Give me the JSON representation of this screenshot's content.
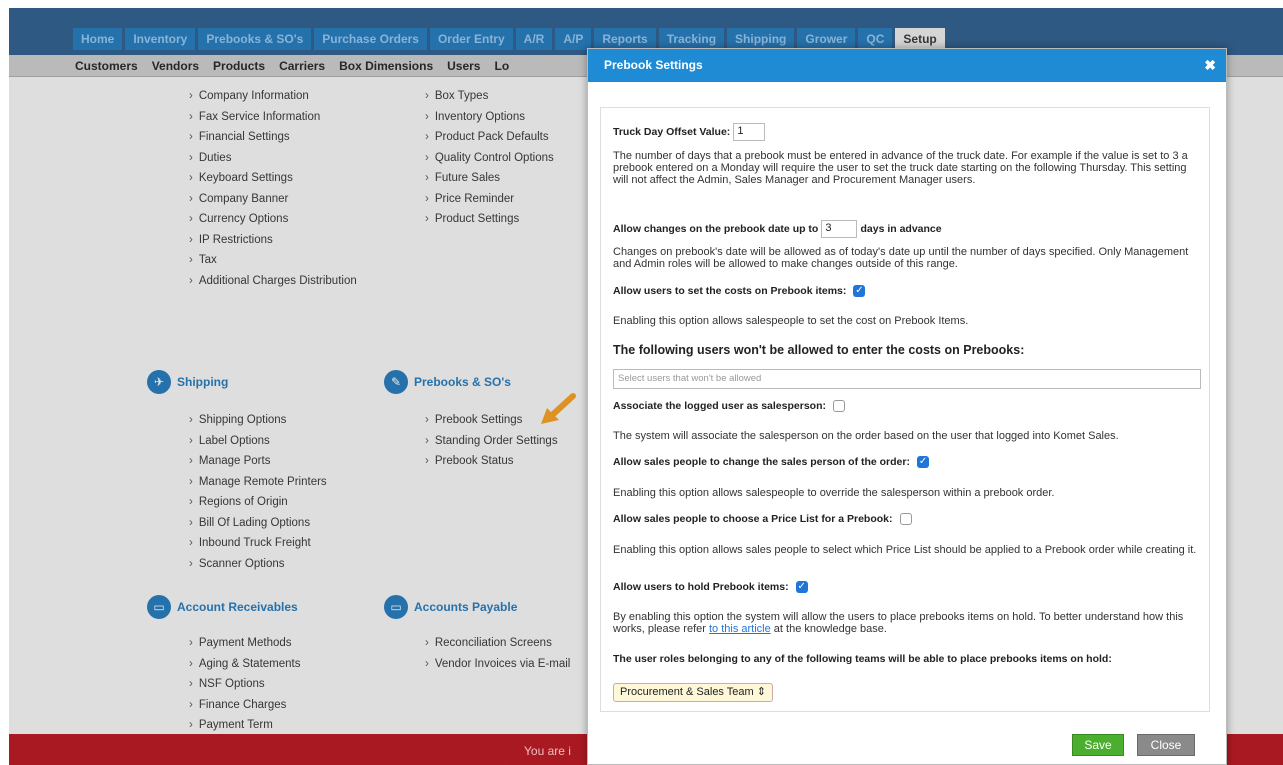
{
  "topnav": {
    "tabs": [
      "Home",
      "Inventory",
      "Prebooks & SO's",
      "Purchase Orders",
      "Order Entry",
      "A/R",
      "A/P",
      "Reports",
      "Tracking",
      "Shipping",
      "Grower",
      "QC",
      "Setup"
    ]
  },
  "subnav": {
    "items": [
      "Customers",
      "Vendors",
      "Products",
      "Carriers",
      "Box Dimensions",
      "Users",
      "Lo"
    ]
  },
  "company_links": [
    "Company Information",
    "Fax Service Information",
    "Financial Settings",
    "Duties",
    "Keyboard Settings",
    "Company Banner",
    "Currency Options",
    "IP Restrictions",
    "Tax",
    "Additional Charges Distribution"
  ],
  "product_links": [
    "Box Types",
    "Inventory Options",
    "Product Pack Defaults",
    "Quality Control Options",
    "Future Sales",
    "Price Reminder",
    "Product Settings"
  ],
  "shipping": {
    "title": "Shipping",
    "links": [
      "Shipping Options",
      "Label Options",
      "Manage Ports",
      "Manage Remote Printers",
      "Regions of Origin",
      "Bill Of Lading Options",
      "Inbound Truck Freight",
      "Scanner Options"
    ]
  },
  "prebooks": {
    "title": "Prebooks & SO's",
    "links": [
      "Prebook Settings",
      "Standing Order Settings",
      "Prebook Status"
    ]
  },
  "receivables": {
    "title": "Account Receivables",
    "links": [
      "Payment Methods",
      "Aging & Statements",
      "NSF Options",
      "Finance Charges",
      "Payment Term"
    ]
  },
  "payables": {
    "title": "Accounts Payable",
    "links": [
      "Reconciliation Screens",
      "Vendor Invoices via E-mail"
    ]
  },
  "footer": {
    "text": "You are i"
  },
  "modal": {
    "title": "Prebook Settings",
    "close_glyph": "✖",
    "truck_label": "Truck Day Offset Value:",
    "truck_value": "1",
    "truck_desc": "The number of days that a prebook must be entered in advance of the truck date. For example if the value is set to 3 a prebook entered on a Monday will require the user to set the truck date starting on the following Thursday. This setting will not affect the Admin, Sales Manager and Procurement Manager users.",
    "allow_changes_prefix": "Allow changes on the prebook date up to",
    "allow_changes_value": "3",
    "allow_changes_suffix": "days in advance",
    "allow_changes_desc": "Changes on prebook's date will be allowed as of today's date up until the number of days specified. Only Management and Admin roles will be allowed to make changes outside of this range.",
    "costs_label": "Allow users to set the costs on Prebook items:",
    "costs_checked": true,
    "costs_desc": "Enabling this option allows salespeople to set the cost on Prebook Items.",
    "restricted_label": "The following users won't be allowed to enter the costs on Prebooks:",
    "restricted_placeholder": "Select users that won't be allowed",
    "associate_label": "Associate the logged user as salesperson:",
    "associate_checked": false,
    "associate_desc": "The system will associate the salesperson on the order based on the user that logged into Komet Sales.",
    "change_sp_label": "Allow sales people to change the sales person of the order:",
    "change_sp_checked": true,
    "change_sp_desc": "Enabling this option allows salespeople to override the salesperson within a prebook order.",
    "pricelist_label": "Allow sales people to choose a Price List for a Prebook:",
    "pricelist_checked": false,
    "pricelist_desc": "Enabling this option allows sales people to select which Price List should be applied to a Prebook order while creating it.",
    "hold_label": "Allow users to hold Prebook items:",
    "hold_checked": true,
    "hold_desc_before": "By enabling this option the system will allow the users to place prebooks items on hold. To better understand how this works, please refer ",
    "hold_link": "to this article",
    "hold_desc_after": " at the knowledge base.",
    "teams_label": "The user roles belonging to any of the following teams will be able to place prebooks items on hold:",
    "team_selected": "Procurement & Sales Team ⇕",
    "save_label": "Save",
    "close_label": "Close"
  },
  "colors": {
    "nav_bg": "#2a5a8a",
    "tab_bg": "#1f76b8",
    "modal_header": "#1f8bd4",
    "save_btn": "#4cae2e",
    "close_btn": "#8a8a8a",
    "footer_bar": "#b5121b",
    "arrow": "#f29b1d"
  }
}
